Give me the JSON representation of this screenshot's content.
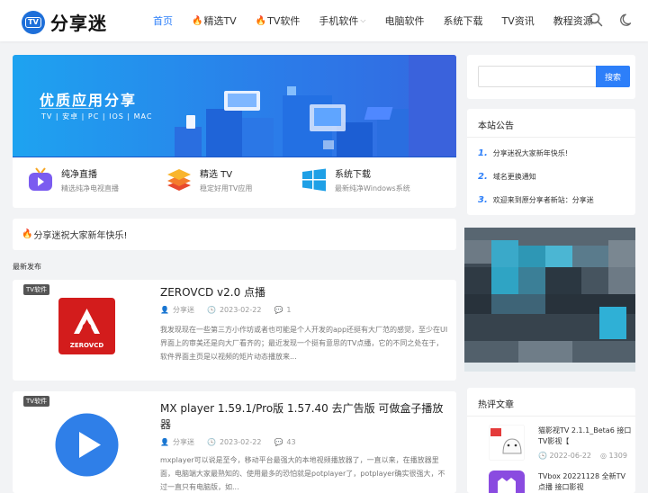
{
  "header": {
    "logo_text": "分享迷",
    "logo_badge": "TV",
    "nav": [
      {
        "label": "首页",
        "active": true
      },
      {
        "label": "精选TV",
        "fire": true
      },
      {
        "label": "TV软件",
        "fire": true
      },
      {
        "label": "手机软件",
        "dropdown": true
      },
      {
        "label": "电脑软件"
      },
      {
        "label": "系统下载"
      },
      {
        "label": "TV资讯"
      },
      {
        "label": "教程资源"
      }
    ],
    "icons": [
      "search-icon",
      "moon-icon"
    ]
  },
  "banner": {
    "title": "优质应用分享",
    "subtitle": "TV | 安卓 | PC | IOS | MAC"
  },
  "quick_links": [
    {
      "title": "纯净直播",
      "desc": "精选纯净电视直播",
      "icon": "tv-live-icon"
    },
    {
      "title": "精选 TV",
      "desc": "稳定好用TV应用",
      "icon": "layers-icon"
    },
    {
      "title": "系统下载",
      "desc": "最新纯净Windows系统",
      "icon": "windows-icon"
    }
  ],
  "notice": {
    "text": "分享迷祝大家新年快乐!"
  },
  "section_label": "最新发布",
  "posts": [
    {
      "tag": "TV软件",
      "title": "ZEROVCD v2.0 点播",
      "author": "分享迷",
      "date": "2023-02-22",
      "comments": "1",
      "excerpt": "我发现现在一些第三方小作坊或者也可能是个人开发的app还挺有大厂范的感觉，至少在UI界面上的审美还是向大厂看齐的；最近发现一个挺有意思的TV点播，它的不同之处在于，软件界面主页是以视频的矩片动态播放来...",
      "thumb_text": "ZEROVCD"
    },
    {
      "tag": "TV软件",
      "title": "MX player 1.59.1/Pro版 1.57.40 去广告版 可做盒子播放器",
      "author": "分享迷",
      "date": "2023-02-22",
      "comments": "43",
      "excerpt": "mxplayer可以说是至今，移动平台最强大的本地视频播放器了，一直以来，在播放器里面，电脑端大家最熟知的、使用最多的恐怕就是potplayer了，potplayer确实很强大，不过一直只有电脑版，如..."
    }
  ],
  "sidebar": {
    "search_button": "搜索",
    "announcement_title": "本站公告",
    "announcements": [
      {
        "num": "1.",
        "text": "分享迷祝大家新年快乐!"
      },
      {
        "num": "2.",
        "text": "域名更换通知"
      },
      {
        "num": "3.",
        "text": "欢迎来到原分享者新站：分享迷"
      }
    ],
    "hot_title": "热评文章",
    "hot": [
      {
        "title": "猫影视TV 2.1.1_Beta6 接口TV影视【",
        "date": "2022-06-22",
        "views": "1309"
      },
      {
        "title": "TVbox 20221128 全新TV点播 接口影视",
        "date": "",
        "views": ""
      }
    ]
  },
  "colors": {
    "accent": "#2d7ff9",
    "fire": "#f5521f",
    "banner_start": "#1ea3f0",
    "banner_end": "#3468e0"
  }
}
